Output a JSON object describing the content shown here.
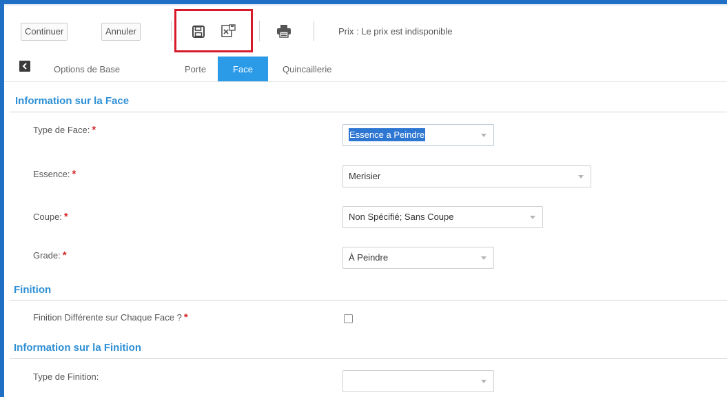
{
  "toolbar": {
    "continue_label": "Continuer",
    "cancel_label": "Annuler",
    "save_icon": "floppy-disk-icon",
    "cancel_edit_icon": "file-close-icon",
    "print_icon": "printer-icon",
    "price_text": "Prix : Le prix est indisponible",
    "highlight_color": "#d71a2a"
  },
  "tabs": {
    "back_icon": "back-icon",
    "items": [
      {
        "label": "Options de Base",
        "active": false
      },
      {
        "label": "Porte",
        "active": false
      },
      {
        "label": "Face",
        "active": true
      },
      {
        "label": "Quincaillerie",
        "active": false
      }
    ],
    "active_color": "#2b9be8"
  },
  "sections": {
    "face_info": {
      "title": "Information sur la Face",
      "fields": [
        {
          "label": "Type de Face:",
          "required": "*",
          "value": "Essence a Peindre"
        },
        {
          "label": "Essence:",
          "required": "*",
          "value": "Merisier"
        },
        {
          "label": "Coupe:",
          "required": "*",
          "value": "Non Spécifié; Sans Coupe"
        },
        {
          "label": "Grade:",
          "required": "*",
          "value": "À Peindre"
        }
      ]
    },
    "finition": {
      "title": "Finition",
      "checkbox_label": "Finition Différente sur Chaque Face ?",
      "required": "*",
      "checked": false
    },
    "finition_info": {
      "title": "Information sur la Finition",
      "fields": [
        {
          "label": "Type de Finition:",
          "value": ""
        }
      ]
    }
  },
  "colors": {
    "section_title": "#2d8fd5",
    "required_marker": "#d12a2a",
    "frame": "#1f6fc4"
  }
}
